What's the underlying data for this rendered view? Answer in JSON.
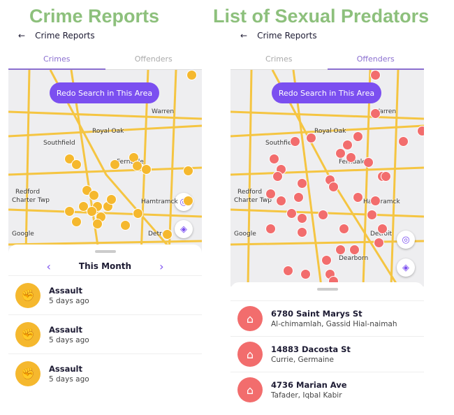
{
  "captions": {
    "left": "Crime Reports",
    "right": "List of Sexual Predators"
  },
  "header": {
    "title": "Crime Reports",
    "back_icon": "arrow-left-icon"
  },
  "tabs": [
    "Crimes",
    "Offenders"
  ],
  "map": {
    "redo_button": "Redo Search in This Area",
    "labels": [
      "Warren",
      "Royal Oak",
      "Southfield",
      "Ferndale",
      "Redford",
      "Charter Twp",
      "Hamtramck",
      "Detroit",
      "Dearborn",
      "Google"
    ],
    "road_color": "#f5c542"
  },
  "crimes": {
    "period": "This Month",
    "marker_color": "#f5b82e",
    "items": [
      {
        "type": "Assault",
        "when": "5 days ago"
      },
      {
        "type": "Assault",
        "when": "5 days ago"
      },
      {
        "type": "Assault",
        "when": "5 days ago"
      }
    ]
  },
  "offenders": {
    "marker_color": "#f26d6d",
    "items": [
      {
        "address": "6780 Saint Marys St",
        "name": "Al-chimamlah, Gassid Hial-naimah"
      },
      {
        "address": "14883 Dacosta St",
        "name": "Currie, Germaine"
      },
      {
        "address": "4736 Marian Ave",
        "name": "Tafader, Iqbal Kabir"
      }
    ]
  }
}
